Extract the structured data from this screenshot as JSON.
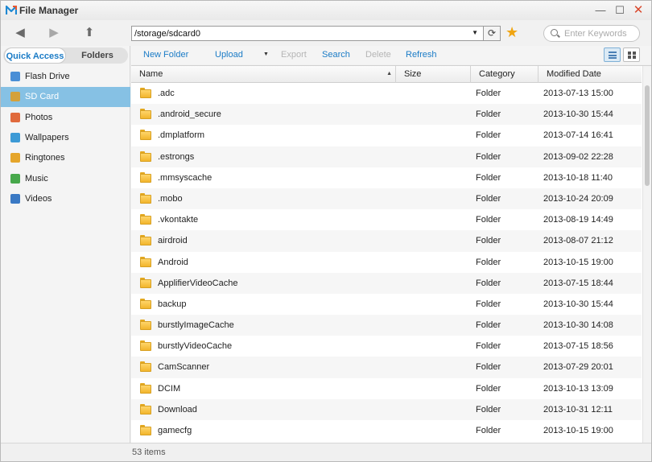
{
  "window": {
    "title": "File Manager",
    "minimize": "—",
    "maximize": "☐",
    "close": "✕"
  },
  "toolbar": {
    "back": "◀",
    "forward": "▶",
    "up": "⬆",
    "path": "/storage/sdcard0",
    "path_dropdown": "▼",
    "go": "⟳",
    "favorite": "★",
    "search_placeholder": "Enter Keywords"
  },
  "sidebar": {
    "tabs": [
      {
        "label": "Quick Access"
      },
      {
        "label": "Folders"
      }
    ],
    "items": [
      {
        "label": "Flash Drive",
        "icon": "flash-drive-icon",
        "color": "#4a8fd6"
      },
      {
        "label": "SD Card",
        "icon": "sd-card-icon",
        "color": "#d4a13b"
      },
      {
        "label": "Photos",
        "icon": "photos-icon",
        "color": "#e06a3c"
      },
      {
        "label": "Wallpapers",
        "icon": "wallpapers-icon",
        "color": "#3d9ad6"
      },
      {
        "label": "Ringtones",
        "icon": "ringtones-icon",
        "color": "#e5a52a"
      },
      {
        "label": "Music",
        "icon": "music-icon",
        "color": "#47a84b"
      },
      {
        "label": "Videos",
        "icon": "videos-icon",
        "color": "#3a79c4"
      }
    ],
    "active_index": 1
  },
  "actions": {
    "new_folder": "New Folder",
    "upload": "Upload",
    "upload_menu": "▼",
    "export": "Export",
    "search": "Search",
    "delete": "Delete",
    "refresh": "Refresh"
  },
  "table": {
    "headers": {
      "name": "Name",
      "name_sort": "▲",
      "size": "Size",
      "category": "Category",
      "modified": "Modified Date"
    },
    "rows": [
      {
        "name": ".adc",
        "category": "Folder",
        "modified": "2013-07-13 15:00"
      },
      {
        "name": ".android_secure",
        "category": "Folder",
        "modified": "2013-10-30 15:44"
      },
      {
        "name": ".dmplatform",
        "category": "Folder",
        "modified": "2013-07-14 16:41"
      },
      {
        "name": ".estrongs",
        "category": "Folder",
        "modified": "2013-09-02 22:28"
      },
      {
        "name": ".mmsyscache",
        "category": "Folder",
        "modified": "2013-10-18 11:40"
      },
      {
        "name": ".mobo",
        "category": "Folder",
        "modified": "2013-10-24 20:09"
      },
      {
        "name": ".vkontakte",
        "category": "Folder",
        "modified": "2013-08-19 14:49"
      },
      {
        "name": "airdroid",
        "category": "Folder",
        "modified": "2013-08-07 21:12"
      },
      {
        "name": "Android",
        "category": "Folder",
        "modified": "2013-10-15 19:00"
      },
      {
        "name": "ApplifierVideoCache",
        "category": "Folder",
        "modified": "2013-07-15 18:44"
      },
      {
        "name": "backup",
        "category": "Folder",
        "modified": "2013-10-30 15:44"
      },
      {
        "name": "burstlyImageCache",
        "category": "Folder",
        "modified": "2013-10-30 14:08"
      },
      {
        "name": "burstlyVideoCache",
        "category": "Folder",
        "modified": "2013-07-15 18:56"
      },
      {
        "name": "CamScanner",
        "category": "Folder",
        "modified": "2013-07-29 20:01"
      },
      {
        "name": "DCIM",
        "category": "Folder",
        "modified": "2013-10-13 13:09"
      },
      {
        "name": "Download",
        "category": "Folder",
        "modified": "2013-10-31 12:11"
      },
      {
        "name": "gamecfg",
        "category": "Folder",
        "modified": "2013-10-15 19:00"
      }
    ]
  },
  "status": {
    "item_count": "53 items"
  }
}
